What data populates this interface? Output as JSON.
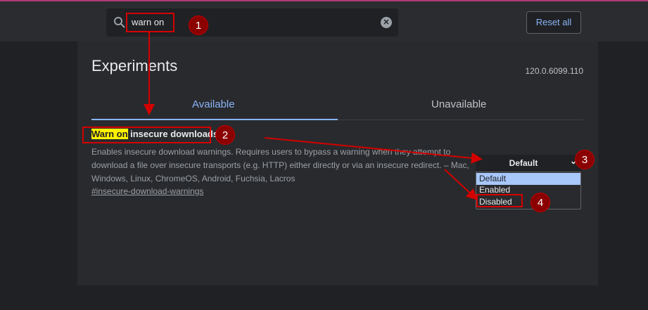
{
  "header": {
    "search_value": "warn on",
    "reset_label": "Reset all",
    "search_icon": "search-icon",
    "clear_icon": "clear-icon"
  },
  "main": {
    "title": "Experiments",
    "version": "120.0.6099.110",
    "tabs": [
      {
        "label": "Available",
        "active": true
      },
      {
        "label": "Unavailable",
        "active": false
      }
    ]
  },
  "experiment": {
    "title_highlight": "Warn on",
    "title_rest": " insecure downloads",
    "description": "Enables insecure download warnings. Requires users to bypass a warning when they attempt to download a file over insecure transports (e.g. HTTP) either directly or via an insecure redirect. – Mac, Windows, Linux, ChromeOS, Android, Fuchsia, Lacros",
    "link": "#insecure-download-warnings",
    "select_value": "Default",
    "options": [
      "Default",
      "Enabled",
      "Disabled"
    ]
  },
  "annotations": {
    "step1": "1",
    "step2": "2",
    "step3": "3",
    "step4": "4",
    "color": "#d40000"
  },
  "colors": {
    "accent": "#8ab4f8",
    "highlight": "#fff200",
    "option_selected": "#a8c7fa"
  }
}
